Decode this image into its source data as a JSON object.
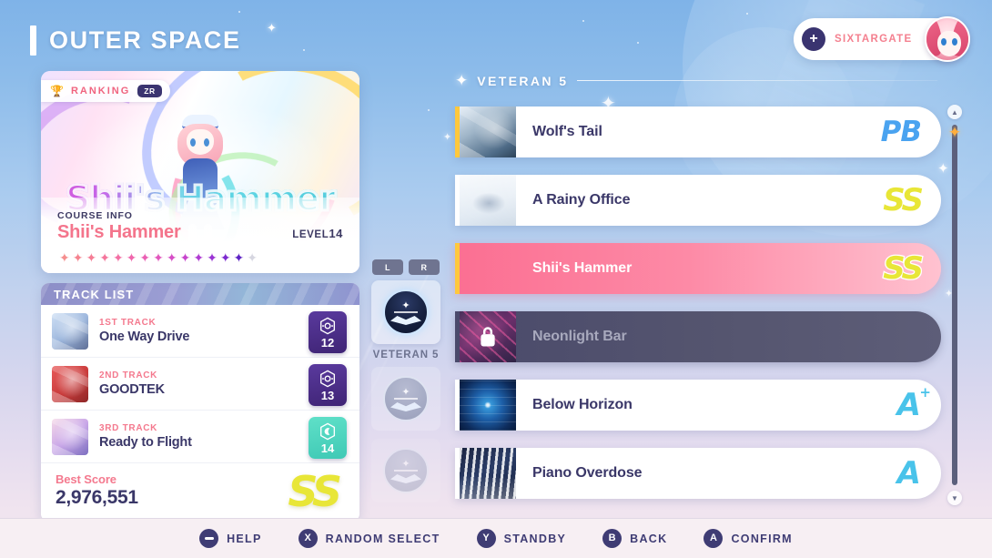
{
  "header": {
    "title": "OUTER SPACE",
    "profile": {
      "name": "SIXTARGATE",
      "add_icon": "plus-icon",
      "avatar_icon": "avatar"
    }
  },
  "course_card": {
    "ranking_badge": {
      "trophy_icon": "trophy-icon",
      "label": "RANKING",
      "chip": "ZR"
    },
    "art_title": "Shii's Hammer",
    "info_label": "COURSE INFO",
    "name": "Shii's Hammer",
    "level_label": "LEVEL",
    "level_value": "14",
    "stars_total": 15,
    "stars_filled": 14,
    "star_colors": [
      "#f58e8e",
      "#f5838f",
      "#f57d95",
      "#f4769c",
      "#f36fa4",
      "#f067ad",
      "#ea60b4",
      "#e257bd",
      "#d64ec6",
      "#c745cd",
      "#b03cd2",
      "#9a33d4",
      "#7d2bcf",
      "#5e23c4"
    ],
    "star_empty_color": "#d6d6e0"
  },
  "track_list": {
    "header": "TRACK LIST",
    "tracks": [
      {
        "order": "1ST TRACK",
        "name": "One Way Drive",
        "level": "12",
        "badge_style": "purple",
        "badge_icon": "hexagon-note-icon",
        "thumb": "th-one"
      },
      {
        "order": "2ND TRACK",
        "name": "GOODTEK",
        "level": "13",
        "badge_style": "purple",
        "badge_icon": "hexagon-note-icon",
        "thumb": "th-two"
      },
      {
        "order": "3RD TRACK",
        "name": "Ready to Flight",
        "level": "14",
        "badge_style": "teal",
        "badge_icon": "hexagon-moon-icon",
        "thumb": "th-three"
      }
    ],
    "best_score_label": "Best Score",
    "best_score_value": "2,976,551",
    "best_score_rank": "SS"
  },
  "tier_selector": {
    "left_button": "L",
    "right_button": "R",
    "active_name": "VETERAN 5",
    "emblem_icon": "veteran-emblem-icon"
  },
  "song_section": {
    "header": {
      "spark_icon": "sparkle-icon",
      "title": "VETERAN 5"
    },
    "songs": [
      {
        "name": "Wolf's Tail",
        "rank": "PB",
        "rank_style": "pb",
        "state": "normal",
        "accent": true,
        "thumb": "st-wolf"
      },
      {
        "name": "A Rainy Office",
        "rank": "SS",
        "rank_style": "ss",
        "state": "normal",
        "accent": false,
        "thumb": "st-piano"
      },
      {
        "name": "Shii's Hammer",
        "rank": "SS",
        "rank_style": "ss",
        "state": "selected",
        "accent": true,
        "thumb": "st-nothumb"
      },
      {
        "name": "Neonlight Bar",
        "rank": "",
        "rank_style": "",
        "state": "locked",
        "accent": false,
        "thumb": "st-neon",
        "lock_icon": "lock-icon"
      },
      {
        "name": "Below Horizon",
        "rank": "A",
        "rank_style": "a-plus",
        "state": "normal",
        "accent": false,
        "thumb": "st-horizon",
        "plus": "+"
      },
      {
        "name": "Piano Overdose",
        "rank": "A",
        "rank_style": "a",
        "state": "normal",
        "accent": false,
        "thumb": "st-overdose"
      }
    ]
  },
  "scrollbar": {
    "up_icon": "chevron-up-icon",
    "down_icon": "chevron-down-icon",
    "thumb_icon": "sparkle-thumb-icon"
  },
  "bottom_bar": {
    "actions": [
      {
        "glyph": "-",
        "glyph_name": "minus-button-icon",
        "label": "HELP"
      },
      {
        "glyph": "X",
        "glyph_name": "x-button-icon",
        "label": "RANDOM SELECT"
      },
      {
        "glyph": "Y",
        "glyph_name": "y-button-icon",
        "label": "STANDBY"
      },
      {
        "glyph": "B",
        "glyph_name": "b-button-icon",
        "label": "BACK"
      },
      {
        "glyph": "A",
        "glyph_name": "a-button-icon",
        "label": "CONFIRM"
      }
    ]
  },
  "colors": {
    "accent_pink": "#f4798e",
    "navy": "#3a3768",
    "gold": "#e8e637",
    "blue": "#4aa3f0",
    "cyan": "#49c3ea",
    "selected_row": "#fb6f92"
  }
}
